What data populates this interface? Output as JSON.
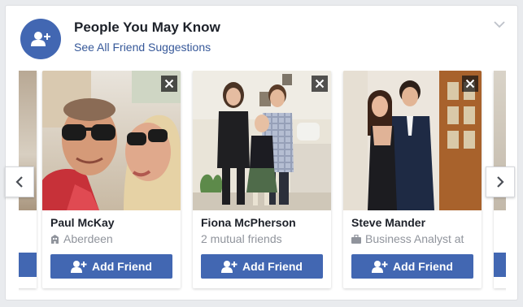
{
  "header": {
    "title": "People You May Know",
    "link": "See All Friend Suggestions"
  },
  "suggestions": [
    {
      "name": "Paul McKay",
      "detail": "Aberdeen",
      "detail_icon": "building-icon",
      "button": "Add Friend"
    },
    {
      "name": "Fiona McPherson",
      "detail": "2 mutual friends",
      "detail_icon": "",
      "button": "Add Friend"
    },
    {
      "name": "Steve Mander",
      "detail": "Business Analyst at",
      "detail_icon": "briefcase-icon",
      "button": "Add Friend"
    }
  ],
  "colors": {
    "brand": "#4267b2",
    "link": "#365899",
    "muted": "#90949c",
    "text": "#1d2129"
  }
}
